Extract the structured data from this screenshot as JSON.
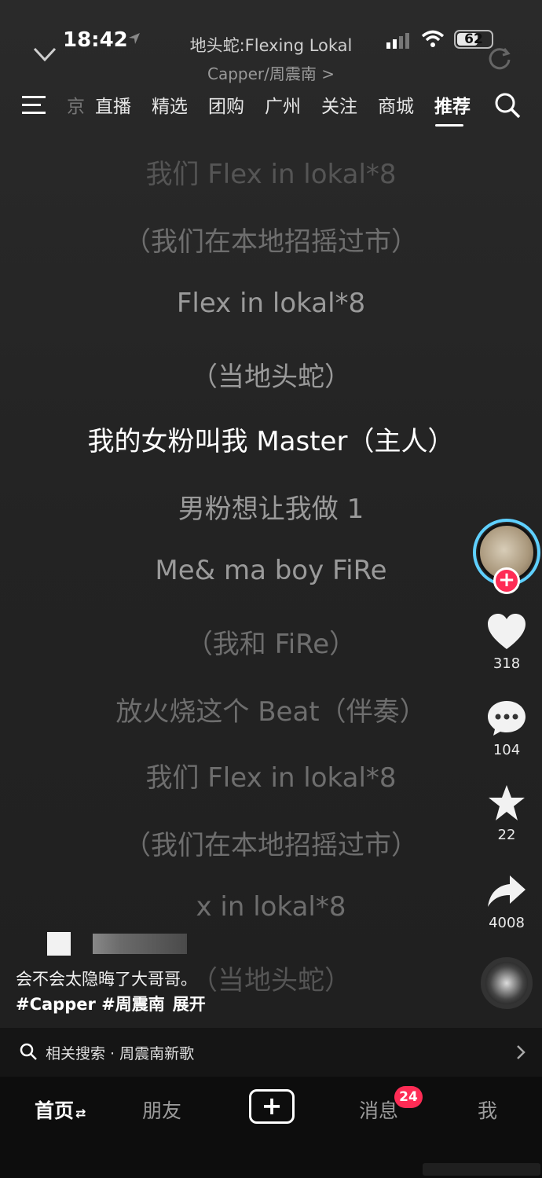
{
  "status_bar": {
    "time": "18:42",
    "battery": "62",
    "battery_level": 0.62
  },
  "player": {
    "title": "地头蛇:Flexing Lokal",
    "artist": "Capper/周震南 >"
  },
  "top_nav": {
    "tabs": [
      {
        "label": "京",
        "partial": true
      },
      {
        "label": "直播"
      },
      {
        "label": "精选"
      },
      {
        "label": "团购"
      },
      {
        "label": "广州"
      },
      {
        "label": "关注"
      },
      {
        "label": "商城"
      },
      {
        "label": "推荐",
        "active": true
      }
    ]
  },
  "lyrics": [
    {
      "text": "我们 Flex in lokal*8",
      "style": "dim"
    },
    {
      "text": "（我们在本地招摇过市）",
      "style": "faded"
    },
    {
      "text": "Flex in lokal*8",
      "style": "mid"
    },
    {
      "text": "（当地头蛇）",
      "style": "mid"
    },
    {
      "text": "我的女粉叫我 Master（主人）",
      "style": "current"
    },
    {
      "text": "男粉想让我做 1",
      "style": "mid"
    },
    {
      "text": "Me& ma boy FiRe",
      "style": "mid"
    },
    {
      "text": "（我和 FiRe）",
      "style": "faded"
    },
    {
      "text": "放火烧这个 Beat（伴奏）",
      "style": "faded"
    },
    {
      "text": "我们 Flex in lokal*8",
      "style": "faded"
    },
    {
      "text": "（我们在本地招摇过市）",
      "style": "faded"
    },
    {
      "text": "x in lokal*8",
      "style": "faded"
    },
    {
      "text": "（当地头蛇）",
      "style": "dim"
    }
  ],
  "rail": {
    "likes": "318",
    "comments": "104",
    "favorites": "22",
    "shares": "4008"
  },
  "caption": {
    "text": "会不会太隐晦了大哥哥。",
    "hashtags": "#Capper #周震南",
    "expand": "展开"
  },
  "related_search": "相关搜索 · 周震南新歌",
  "tabbar": {
    "home": "首页",
    "friends": "朋友",
    "add": "+",
    "messages": "消息",
    "messages_badge": "24",
    "me": "我"
  },
  "colors": {
    "accent": "#fe2c55",
    "ring": "#5fd0ff",
    "background": "#1e1e1e"
  },
  "icons": [
    "location-arrow-icon",
    "signal-icon",
    "wifi-icon",
    "battery-icon",
    "chevron-down-icon",
    "refresh-icon",
    "menu-icon",
    "search-icon",
    "heart-icon",
    "comment-icon",
    "star-icon",
    "share-icon",
    "music-disc-icon",
    "chevron-right-icon",
    "plus-icon"
  ]
}
